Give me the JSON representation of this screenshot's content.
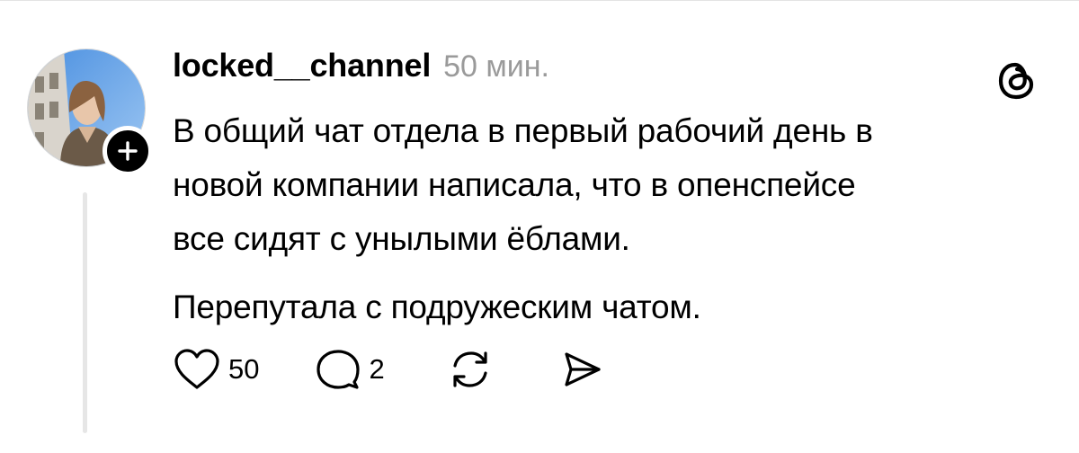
{
  "post": {
    "username": "locked__channel",
    "timestamp": "50 мин.",
    "paragraphs": [
      "В общий чат отдела в первый рабочий день в",
      "новой компании написала, что в опенспейсе",
      "все сидят с унылыми ёблами.",
      "Перепутала с подружеским чатом."
    ],
    "likes": "50",
    "replies": "2"
  },
  "icons": {
    "avatar": "profile-photo",
    "follow": "plus-icon",
    "brand": "threads-logo-icon",
    "like": "heart-icon",
    "reply": "comment-bubble-icon",
    "repost": "repost-icon",
    "share": "send-icon"
  },
  "colors": {
    "text": "#000000",
    "muted": "#9a9a9a",
    "thread_line": "#e6e6e6",
    "badge": "#000000"
  }
}
